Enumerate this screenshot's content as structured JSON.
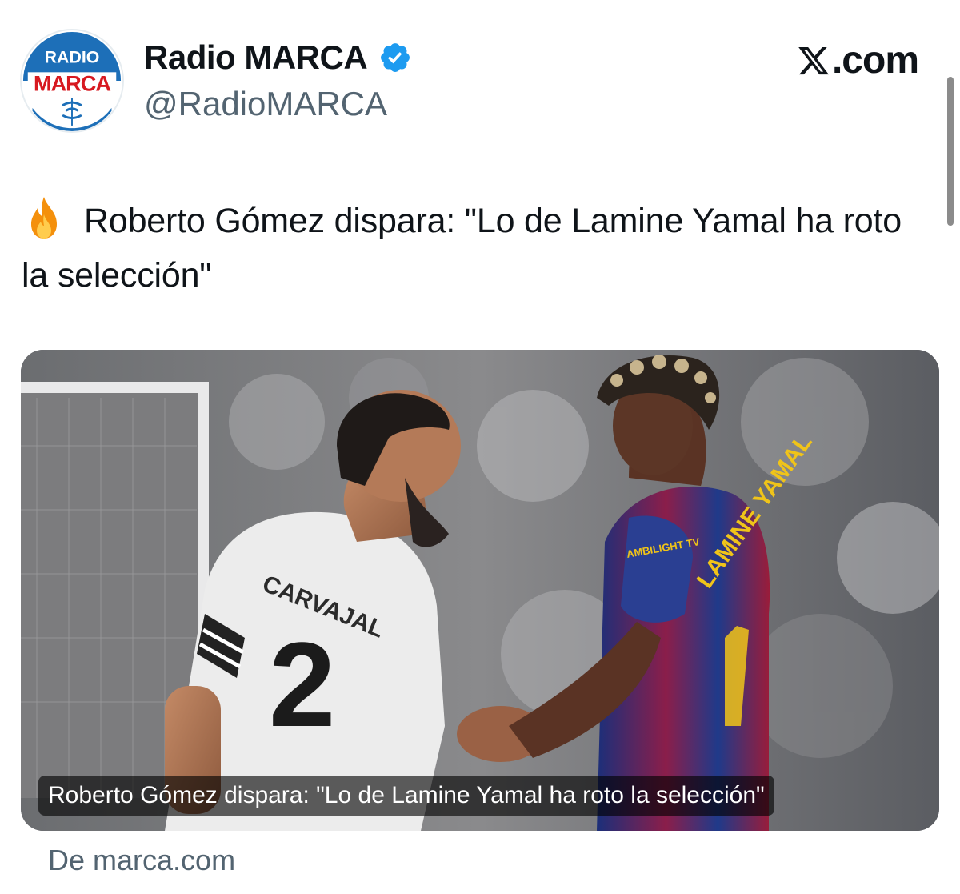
{
  "account": {
    "display_name": "Radio MARCA",
    "handle": "@RadioMARCA",
    "verified": true,
    "verified_icon": "verified-badge-icon",
    "avatar": {
      "icon": "radio-marca-logo",
      "line1": "RADIO",
      "line2": "MARCA"
    }
  },
  "platform": {
    "label": ".com",
    "icon": "x-logo-icon"
  },
  "tweet": {
    "emoji_icon": "fire-icon",
    "text": "Roberto Gómez dispara: \"Lo de Lamine Yamal ha roto la selección\""
  },
  "link_card": {
    "image": {
      "left_jersey_name": "CARVAJAL",
      "left_jersey_number": "2",
      "right_jersey_name": "LAMINE YAMAL",
      "sponsor": "AMBILIGHT TV"
    },
    "caption": "Roberto Gómez dispara: \"Lo de Lamine Yamal ha roto la selección\"",
    "source": "De marca.com"
  },
  "colors": {
    "brand_blue": "#1d6fb8",
    "brand_red": "#d71920",
    "verified_blue": "#1d9bf0",
    "secondary_text": "#536471"
  }
}
